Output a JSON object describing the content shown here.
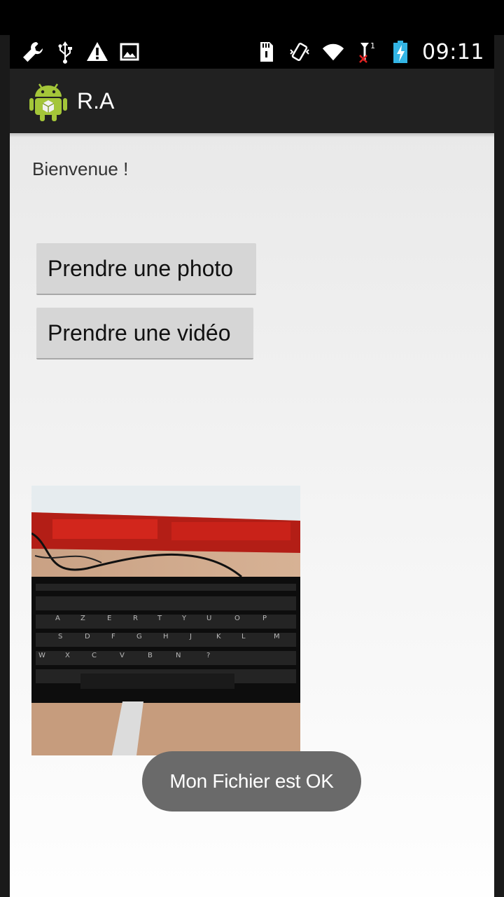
{
  "status_bar": {
    "time": "09:11",
    "left_icons": [
      "wrench-icon",
      "usb-icon",
      "warning-icon",
      "image-icon"
    ],
    "right_icons": [
      "sd-card-icon",
      "vibrate-icon",
      "wifi-icon",
      "no-signal-icon",
      "battery-charging-icon"
    ]
  },
  "action_bar": {
    "app_title": "R.A",
    "app_icon": "android-icon"
  },
  "main": {
    "welcome_text": "Bienvenue !",
    "photo_button_label": "Prendre une photo",
    "video_button_label": "Prendre une vidéo",
    "preview_image": "keyboard-photo"
  },
  "toast": {
    "message": "Mon Fichier est OK"
  },
  "colors": {
    "action_bar_bg": "#212121",
    "content_bg": "#f2f2f2",
    "button_bg": "#d6d6d6",
    "toast_bg": "#6a6a6a",
    "android_green": "#a4c639",
    "battery_blue": "#33b5e5"
  }
}
